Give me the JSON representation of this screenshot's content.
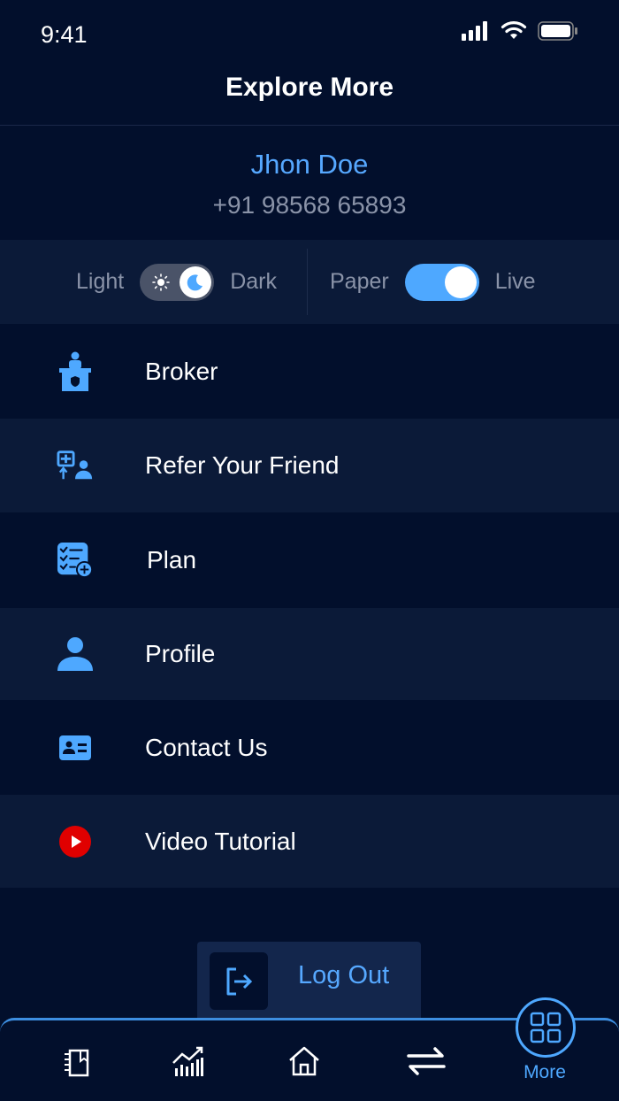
{
  "status": {
    "time": "9:41"
  },
  "header": {
    "title": "Explore More"
  },
  "user": {
    "name": "Jhon Doe",
    "phone": "+91 98568 65893"
  },
  "toggles": {
    "theme": {
      "left_label": "Light",
      "right_label": "Dark",
      "on": true
    },
    "mode": {
      "left_label": "Paper",
      "right_label": "Live",
      "on": true
    }
  },
  "menu": {
    "items": [
      {
        "label": "Broker",
        "icon": "broker-icon"
      },
      {
        "label": "Refer Your Friend",
        "icon": "refer-icon"
      },
      {
        "label": "Plan",
        "icon": "plan-icon"
      },
      {
        "label": "Profile",
        "icon": "profile-icon"
      },
      {
        "label": "Contact Us",
        "icon": "contact-icon"
      },
      {
        "label": "Video Tutorial",
        "icon": "youtube-icon"
      }
    ]
  },
  "logout": {
    "label": "Log Out"
  },
  "tabbar": {
    "tabs": [
      "watchlist-icon",
      "chart-icon",
      "home-icon",
      "transfer-icon",
      "grid-icon"
    ],
    "more_label": "More"
  },
  "colors": {
    "background": "#020f2c",
    "accent": "#4ea8ff",
    "row_alt": "#0b1a38",
    "youtube": "#e00000"
  }
}
